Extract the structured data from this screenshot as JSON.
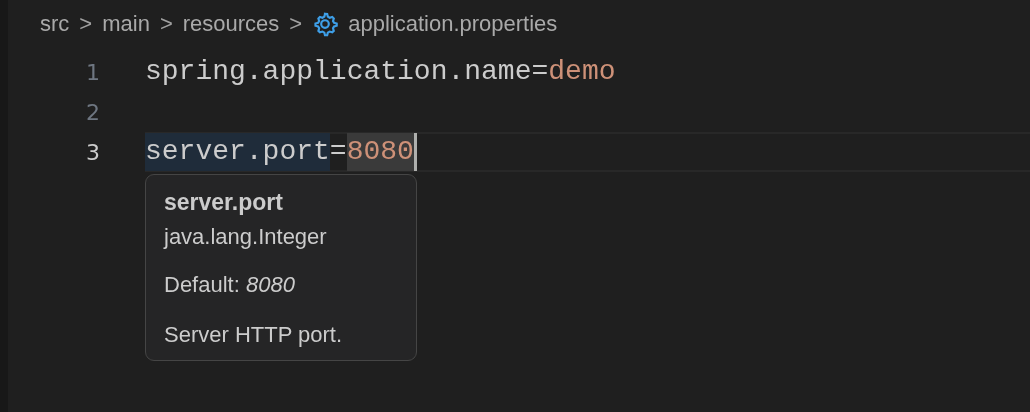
{
  "breadcrumb": [
    {
      "label": "src",
      "kind": "folder"
    },
    {
      "label": "main",
      "kind": "folder"
    },
    {
      "label": "resources",
      "kind": "folder"
    },
    {
      "label": "application.properties",
      "kind": "settings-file"
    }
  ],
  "separator": ">",
  "lines": [
    {
      "number": "1",
      "current": false,
      "tokens": [
        {
          "text": "spring.application.name",
          "kind": "key",
          "highlighted": false
        },
        {
          "text": "=",
          "kind": "operator",
          "highlighted": false
        },
        {
          "text": "demo",
          "kind": "value",
          "highlighted": false
        }
      ]
    },
    {
      "number": "2",
      "current": false
    },
    {
      "number": "3",
      "current": true,
      "tokens": [
        {
          "text": "server.port",
          "kind": "key",
          "highlighted": true
        },
        {
          "text": "=",
          "kind": "operator",
          "highlighted": false
        },
        {
          "text": "8080",
          "kind": "value",
          "highlighted": true
        }
      ]
    }
  ],
  "hover": {
    "title": "server.port",
    "type": "java.lang.Integer",
    "default": "Default: *8080*",
    "description": "Server HTTP port."
  }
}
